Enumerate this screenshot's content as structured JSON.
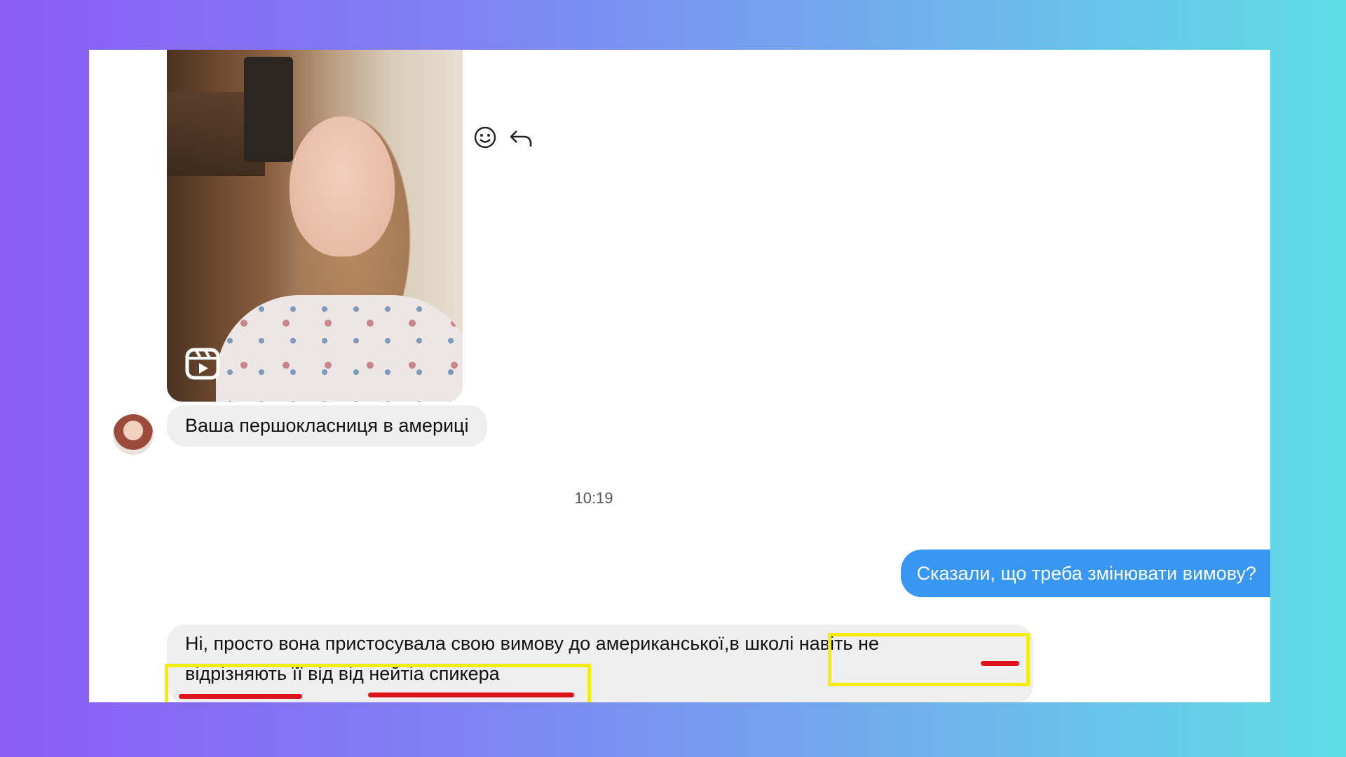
{
  "chat": {
    "reel_icon": "reel-play-icon",
    "reaction_icons": [
      "emoji-smile-icon",
      "reply-arrow-icon"
    ],
    "incoming_1": "Ваша першокласниця в америці",
    "timestamp": "10:19",
    "outgoing_1": "Сказали, що треба змінювати вимову?",
    "incoming_2": {
      "line1_a": "Ні, просто вона пристосувала свою вимову до американської,",
      "line1_b": "в школі навіть",
      "line1_c": "не",
      "line2_a": "відрізняють",
      "line2_b": "її  від",
      "line2_c": "від нейтіа спикера"
    }
  },
  "annotation_colors": {
    "highlight_box": "#f4ec0c",
    "underline": "#e0121b"
  },
  "colors": {
    "outgoing_bubble": "#3897f0",
    "incoming_bubble": "#efefef"
  }
}
